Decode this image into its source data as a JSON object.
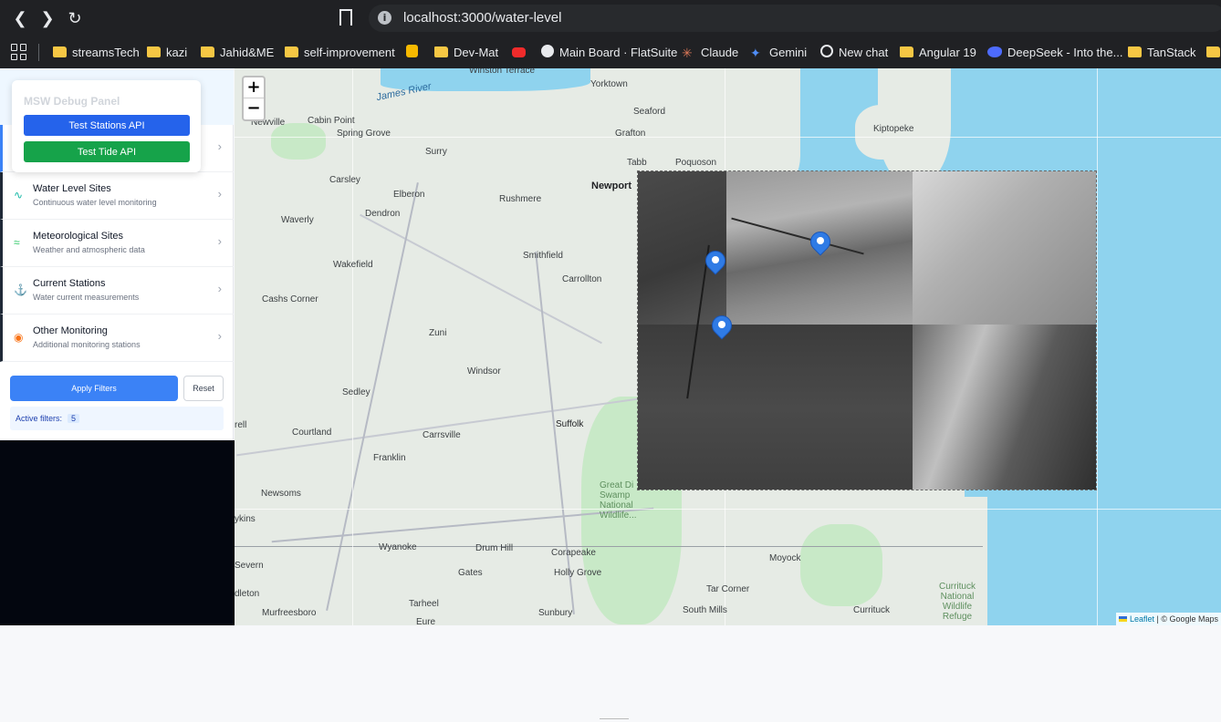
{
  "browser": {
    "url": "localhost:3000/water-level",
    "bookmarks": [
      {
        "label": "streamsTech",
        "icon": "folder-icon"
      },
      {
        "label": "kazi",
        "icon": "folder-icon"
      },
      {
        "label": "Jahid&ME",
        "icon": "folder-icon"
      },
      {
        "label": "self-improvement",
        "icon": "folder-icon"
      },
      {
        "label": "",
        "icon": "keep-icon"
      },
      {
        "label": "Dev-Mat",
        "icon": "folder-icon"
      },
      {
        "label": "",
        "icon": "youtube-icon"
      },
      {
        "label": "Main Board · FlatSuite",
        "icon": "github-icon"
      },
      {
        "label": "Claude",
        "icon": "claude-icon"
      },
      {
        "label": "Gemini",
        "icon": "gemini-icon"
      },
      {
        "label": "New chat",
        "icon": "chatgpt-icon"
      },
      {
        "label": "Angular 19",
        "icon": "folder-icon"
      },
      {
        "label": "DeepSeek - Into the...",
        "icon": "deepseek-icon"
      },
      {
        "label": "TanStack",
        "icon": "folder-icon"
      }
    ]
  },
  "debug_panel": {
    "title": "MSW Debug Panel",
    "stations_btn": "Test Stations API",
    "tide_btn": "Test Tide API"
  },
  "sidebar": {
    "items": [
      {
        "title": "Water Level Sites",
        "subtitle": "Continuous water level monitoring",
        "icon": "wave-icon",
        "color": "#14b8a6"
      },
      {
        "title": "Meteorological Sites",
        "subtitle": "Weather and atmospheric data",
        "icon": "wind-icon",
        "color": "#22c55e"
      },
      {
        "title": "Current Stations",
        "subtitle": "Water current measurements",
        "icon": "anchor-icon",
        "color": "#a855f7"
      },
      {
        "title": "Other Monitoring",
        "subtitle": "Additional monitoring stations",
        "icon": "pin-icon",
        "color": "#f97316"
      }
    ],
    "apply_label": "Apply Filters",
    "reset_label": "Reset",
    "active_filters_label": "Active filters:",
    "active_filters_count": "5"
  },
  "map": {
    "zoom_in": "+",
    "zoom_out": "−",
    "attribution_leaflet": "Leaflet",
    "attribution_rest": " | © Google Maps",
    "water_labels": [
      "James River"
    ],
    "towns": [
      "Winston Terrace",
      "Yorktown",
      "Seaford",
      "Grafton",
      "Tabb",
      "Poquoson",
      "Newport",
      "Kiptopeke",
      "Newville",
      "Cabin Point",
      "Spring Grove",
      "Surry",
      "Carsley",
      "Elberon",
      "Rushmere",
      "Dendron",
      "Waverly",
      "Wakefield",
      "Smithfield",
      "Carrollton",
      "Cashs Corner",
      "Zuni",
      "Windsor",
      "Sedley",
      "Suffolk",
      "Courtland",
      "Carrsville",
      "Franklin",
      "Newsoms",
      "Great Di Swamp National Wildlife...",
      "Wyanoke",
      "Drum Hill",
      "Corapeake",
      "Moyock",
      "Gates",
      "Holly Grove",
      "Severn",
      "Tar Corner",
      "Tarheel",
      "South Mills",
      "Currituck",
      "Currituck National Wildlife Refuge",
      "Murfreesboro",
      "Sunbury",
      "Eure",
      "rell",
      "ykins",
      "dleton"
    ]
  },
  "markers": [
    {
      "name": "station-marker-1"
    },
    {
      "name": "station-marker-2"
    },
    {
      "name": "station-marker-3"
    }
  ]
}
